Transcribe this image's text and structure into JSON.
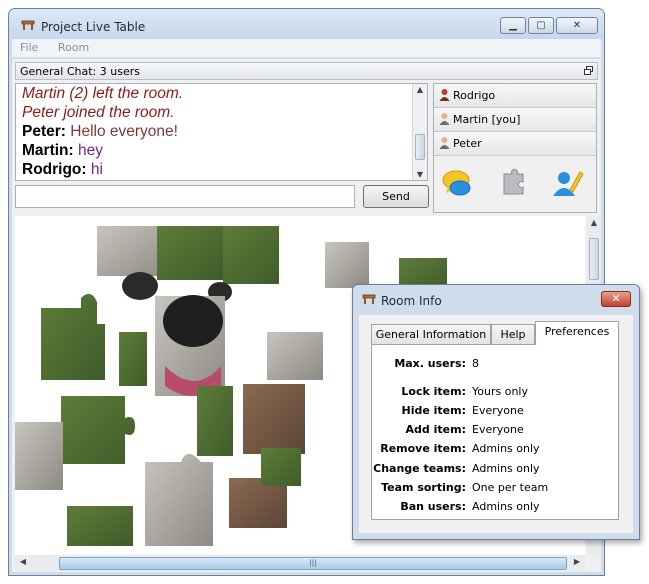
{
  "window": {
    "title": "Project Live Table",
    "app_icon": "table-icon"
  },
  "menu": [
    "File",
    "Room"
  ],
  "chat": {
    "header": "General Chat: 3 users",
    "lines": [
      {
        "kind": "system",
        "text": "Martin (2) left the room."
      },
      {
        "kind": "system",
        "text": "Peter joined the room."
      },
      {
        "kind": "message",
        "user": "Peter:",
        "text": "Hello everyone!",
        "color": "#7b3a3a"
      },
      {
        "kind": "message",
        "user": "Martin:",
        "text": "hey",
        "color": "#6a2a8a"
      },
      {
        "kind": "message",
        "user": "Rodrigo:",
        "text": "hi",
        "color": "#6a2a8a"
      }
    ],
    "input_value": "",
    "send_label": "Send"
  },
  "users": [
    {
      "name": "Rodrigo",
      "icon": "user-red-icon"
    },
    {
      "name": "Martin [you]",
      "icon": "user-icon"
    },
    {
      "name": "Peter",
      "icon": "user-icon"
    }
  ],
  "user_actions": [
    "chat-bubble-icon",
    "puzzle-icon",
    "edit-user-icon"
  ],
  "dialog": {
    "title": "Room Info",
    "tabs": [
      "General Information",
      "Help",
      "Preferences"
    ],
    "active_tab": "Preferences",
    "preferences": [
      {
        "key": "Max. users:",
        "value": "8"
      },
      {
        "key": "Lock item:",
        "value": "Yours only"
      },
      {
        "key": "Hide item:",
        "value": "Everyone"
      },
      {
        "key": "Add item:",
        "value": "Everyone"
      },
      {
        "key": "Remove item:",
        "value": "Admins only"
      },
      {
        "key": "Change teams:",
        "value": "Admins only"
      },
      {
        "key": "Team sorting:",
        "value": "One per team"
      },
      {
        "key": "Ban users:",
        "value": "Admins only"
      }
    ]
  },
  "colors": {
    "frame": "#cfdcec",
    "system_message": "#8b1a1a",
    "close_button": "#c2412b"
  }
}
